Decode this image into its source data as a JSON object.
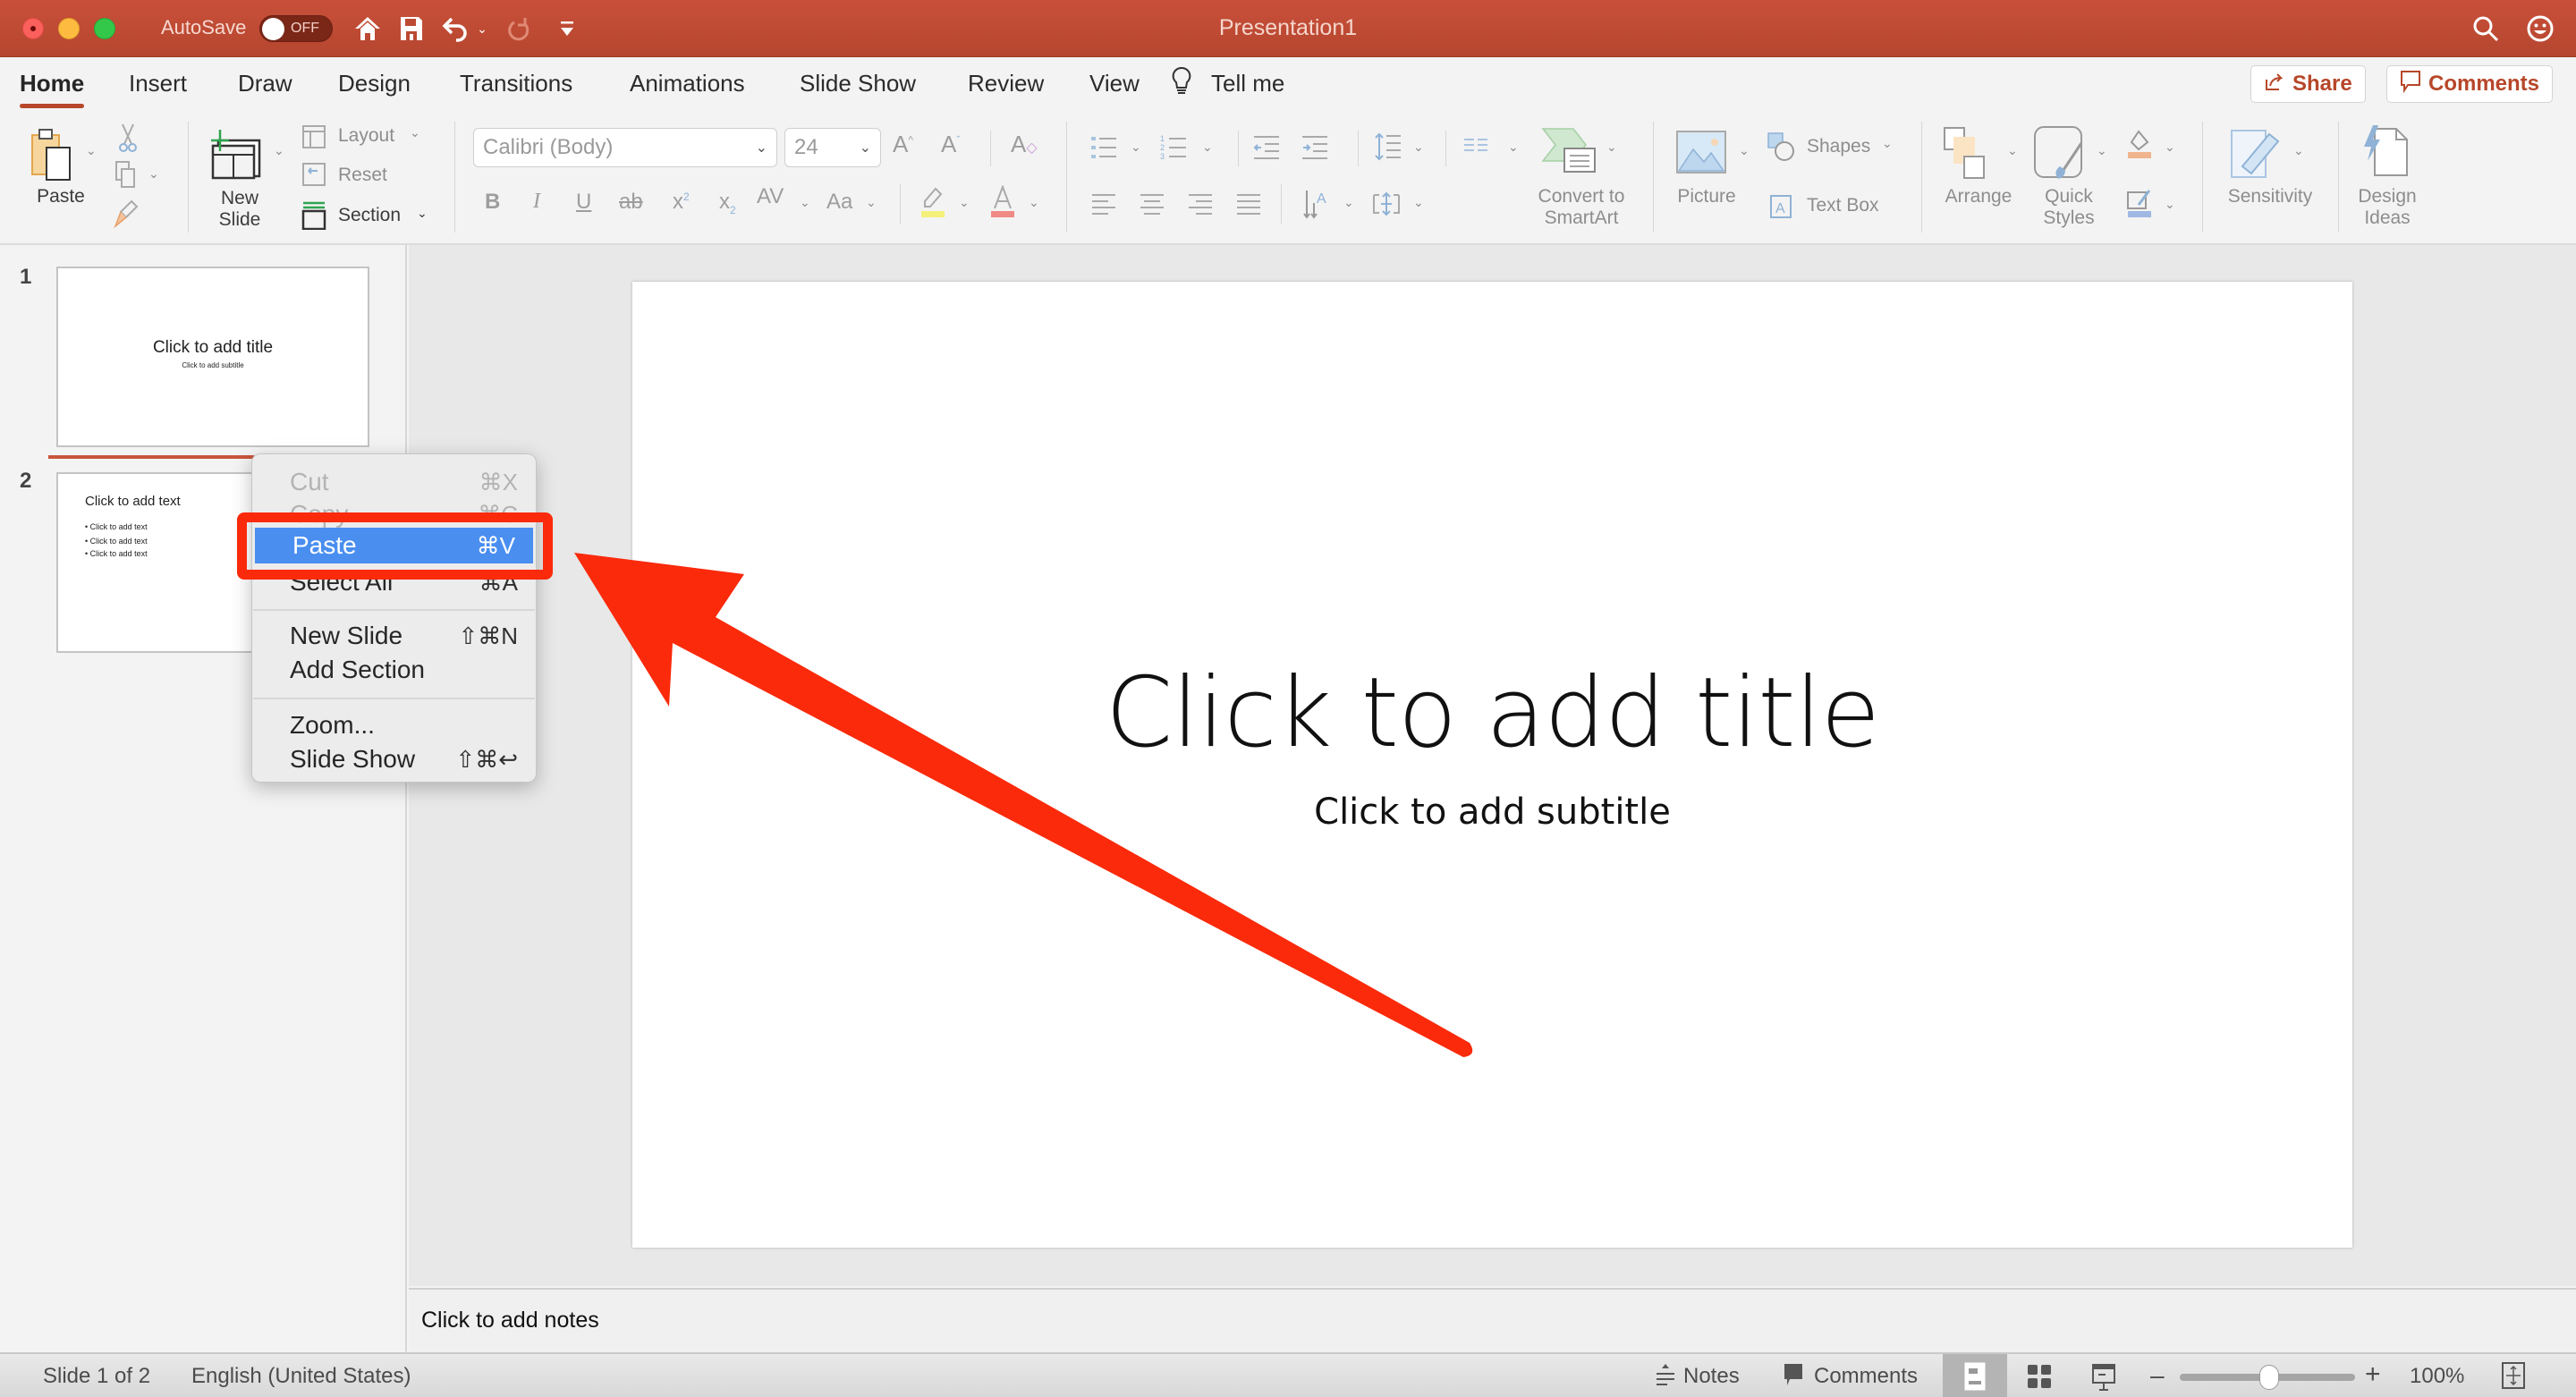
{
  "titlebar": {
    "autosave_label": "AutoSave",
    "autosave_state": "OFF",
    "document_title": "Presentation1"
  },
  "tabs": [
    {
      "label": "Home",
      "active": true
    },
    {
      "label": "Insert"
    },
    {
      "label": "Draw"
    },
    {
      "label": "Design"
    },
    {
      "label": "Transitions"
    },
    {
      "label": "Animations"
    },
    {
      "label": "Slide Show"
    },
    {
      "label": "Review"
    },
    {
      "label": "View"
    }
  ],
  "tell_me": "Tell me",
  "share_label": "Share",
  "comments_label": "Comments",
  "ribbon": {
    "paste": "Paste",
    "new_slide_1": "New",
    "new_slide_2": "Slide",
    "layout": "Layout",
    "reset": "Reset",
    "section": "Section",
    "font_name": "Calibri (Body)",
    "font_size": "24",
    "convert_1": "Convert to",
    "convert_2": "SmartArt",
    "picture": "Picture",
    "shapes": "Shapes",
    "text_box": "Text Box",
    "arrange": "Arrange",
    "quick_styles_1": "Quick",
    "quick_styles_2": "Styles",
    "sensitivity": "Sensitivity",
    "design_ideas_1": "Design",
    "design_ideas_2": "Ideas"
  },
  "slides": [
    {
      "number": "1",
      "title": "Click to add title",
      "subtitle": "Click to add subtitle"
    },
    {
      "number": "2",
      "heading": "Click to add text",
      "bullets": [
        "• Click to add text",
        "• Click to add text",
        "• Click to add text"
      ]
    }
  ],
  "current_slide": {
    "title": "Click to add title",
    "subtitle": "Click to add subtitle"
  },
  "notes_placeholder": "Click to add notes",
  "context_menu": {
    "items": [
      {
        "label": "Cut",
        "shortcut": "⌘X",
        "disabled": true
      },
      {
        "label": "Copy",
        "shortcut": "⌘C",
        "disabled": true
      },
      {
        "label": "Paste",
        "shortcut": "⌘V",
        "highlighted": true
      },
      {
        "label": "Select All",
        "shortcut": "⌘A"
      },
      {
        "label": "New Slide",
        "shortcut": "⇧⌘N"
      },
      {
        "label": "Add Section",
        "shortcut": ""
      },
      {
        "label": "Zoom...",
        "shortcut": ""
      },
      {
        "label": "Slide Show",
        "shortcut": "⇧⌘↩"
      }
    ]
  },
  "status": {
    "slide_position": "Slide 1 of 2",
    "language": "English (United States)",
    "notes": "Notes",
    "comments": "Comments",
    "zoom_level": "100%",
    "zoom_fraction": 0.5
  },
  "colors": {
    "accent": "#b7472a",
    "highlight": "#4a8ef0",
    "annotation": "#fa2a0b"
  }
}
